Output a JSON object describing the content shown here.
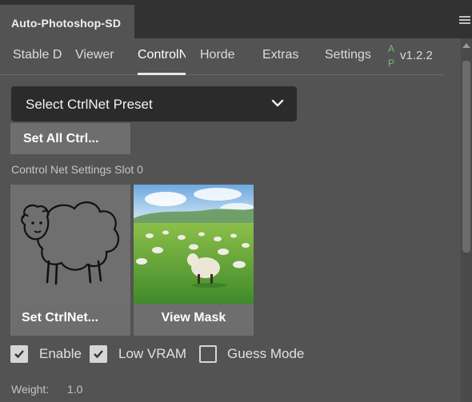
{
  "panel": {
    "title": "Auto-Photoshop-SD"
  },
  "tabs": [
    {
      "label": "Stable D"
    },
    {
      "label": "Viewer"
    },
    {
      "label": "ControlN"
    },
    {
      "label": "Horde"
    },
    {
      "label": "Extras"
    },
    {
      "label": "Settings"
    }
  ],
  "badge": {
    "top": "A",
    "bottom": "P"
  },
  "version": "v1.2.2",
  "preset_select": {
    "label": "Select CtrlNet Preset"
  },
  "set_all_button": {
    "label": "Set All Ctrl..."
  },
  "slot": {
    "label": "Control Net Settings Slot 0",
    "set_button": "Set CtrlNet...",
    "view_mask_button": "View Mask"
  },
  "options": {
    "enable": {
      "label": "Enable",
      "checked": true
    },
    "low_vram": {
      "label": "Low VRAM",
      "checked": true
    },
    "guess_mode": {
      "label": "Guess Mode",
      "checked": false
    }
  },
  "weight": {
    "label": "Weight:",
    "value": "1.0"
  },
  "colors": {
    "accent": "#6ec26e",
    "panel_bg": "#535353",
    "topbar_bg": "#323232"
  }
}
